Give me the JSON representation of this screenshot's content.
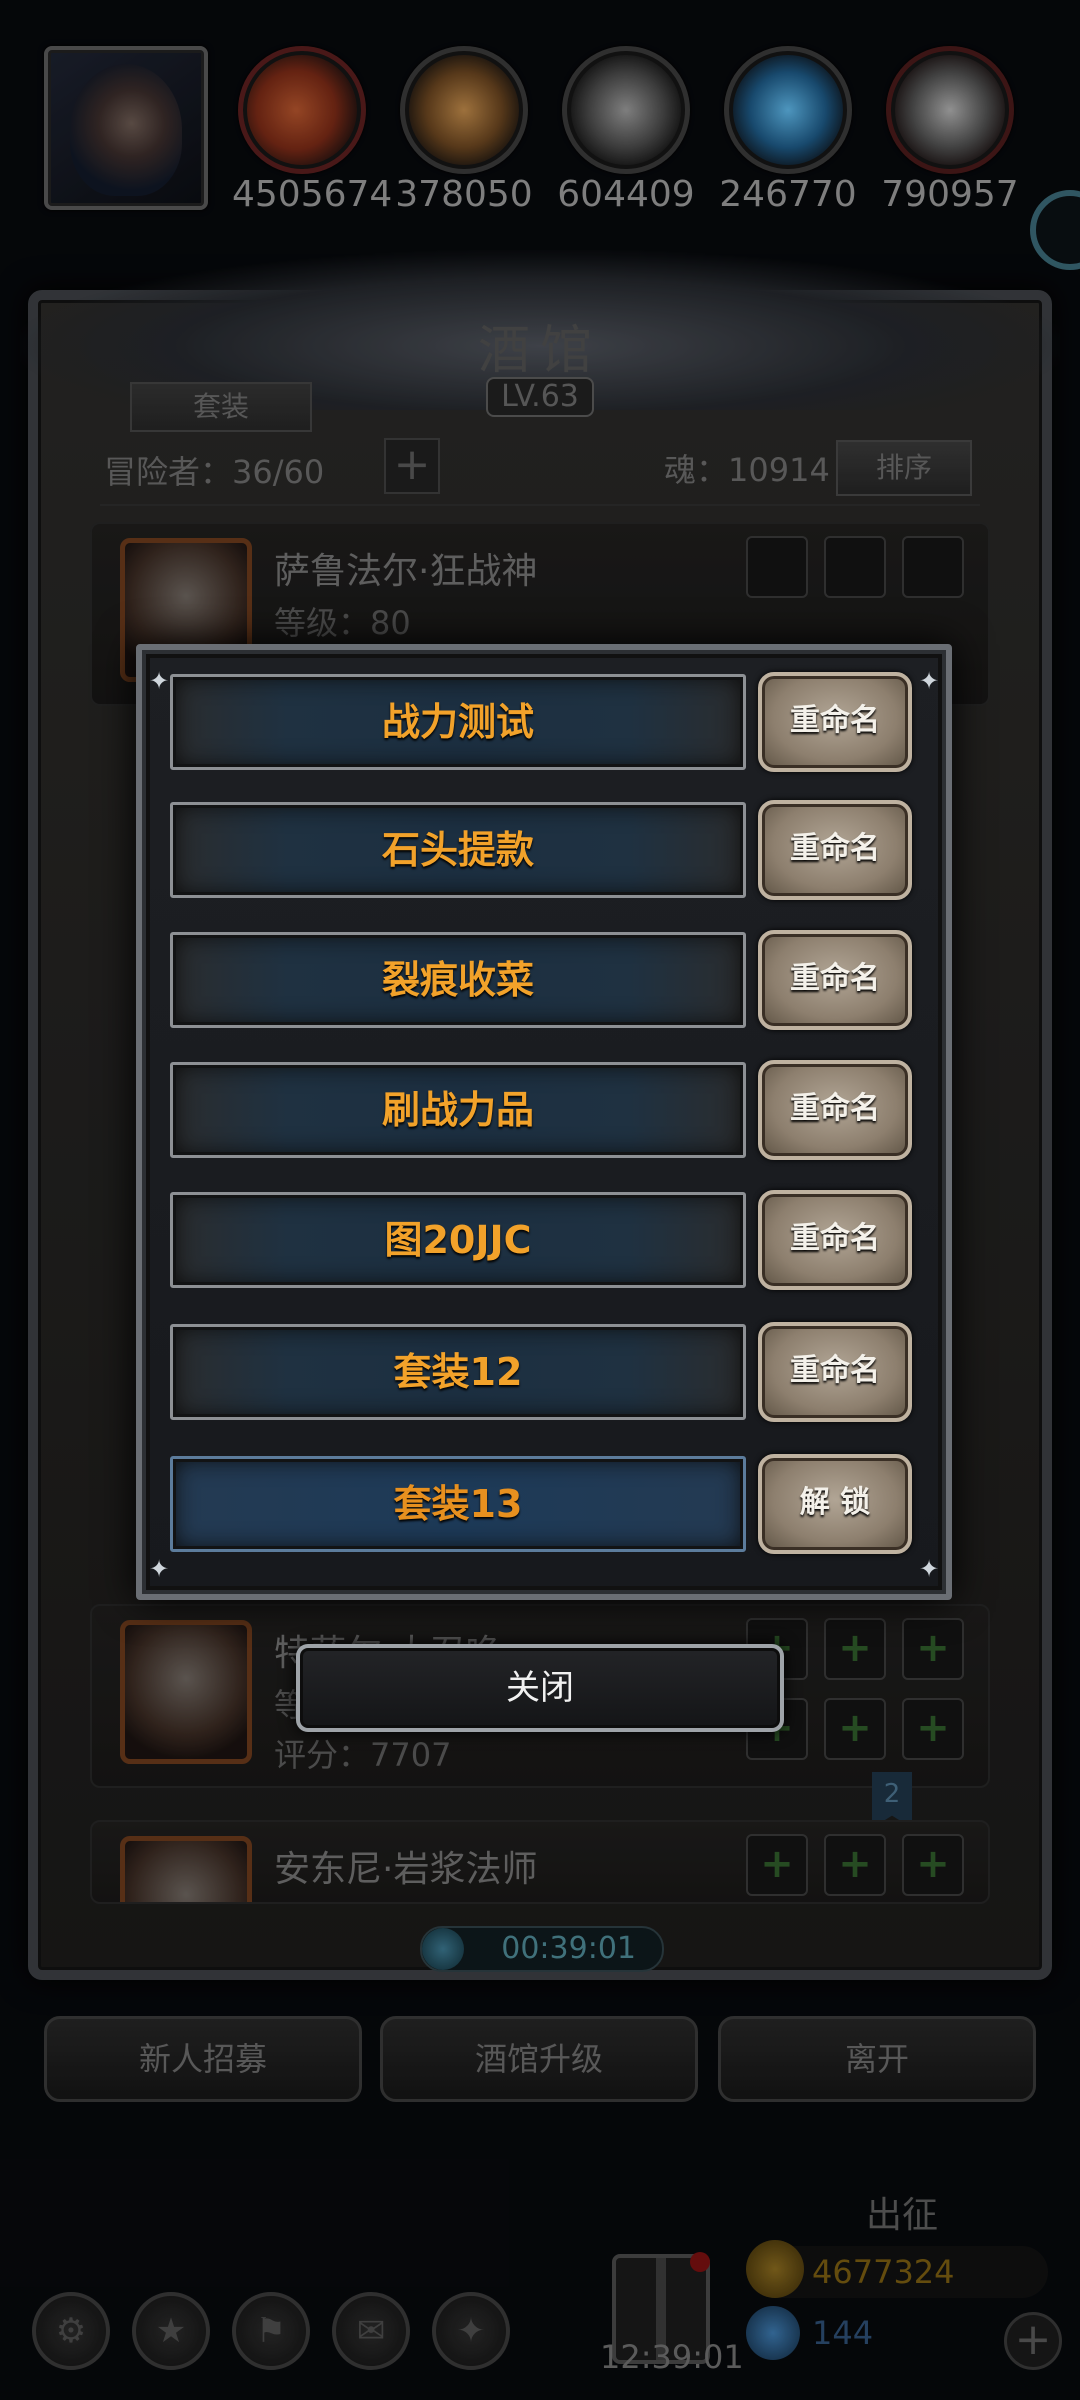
{
  "resources": [
    {
      "icon": "meat-icon",
      "value": "4505674"
    },
    {
      "icon": "wood-icon",
      "value": "378050"
    },
    {
      "icon": "iron-icon",
      "value": "604409"
    },
    {
      "icon": "crystal-icon",
      "value": "246770"
    },
    {
      "icon": "metal-icon",
      "value": "790957"
    }
  ],
  "tavern": {
    "title": "酒馆",
    "level": "LV.63",
    "set_tab": "套装",
    "adventurers": "冒险者：36/60",
    "add_symbol": "+",
    "soul": "魂：10914",
    "sort": "排序"
  },
  "heroes": [
    {
      "name": "萨鲁法尔·狂战神",
      "level": "等级：80"
    },
    {
      "name": "特萨尔·大召唤",
      "level": "等",
      "score": "评分：7707"
    },
    {
      "name": "安东尼·岩浆法师"
    }
  ],
  "page_flag": "2",
  "timer": "00:39:01",
  "bottom_buttons": {
    "recruit": "新人招募",
    "upgrade": "酒馆升级",
    "leave": "离开"
  },
  "footer": {
    "expedition": "出征",
    "clock": "12:39:01",
    "gold": "4677324",
    "gems": "144",
    "plus": "+"
  },
  "modal": {
    "sets": [
      {
        "name": "战力测试",
        "action": "重命名"
      },
      {
        "name": "石头提款",
        "action": "重命名"
      },
      {
        "name": "裂痕收菜",
        "action": "重命名"
      },
      {
        "name": "刷战力品",
        "action": "重命名"
      },
      {
        "name": "图20JJC",
        "action": "重命名"
      },
      {
        "name": "套装12",
        "action": "重命名"
      },
      {
        "name": "套装13",
        "action": "解 锁",
        "locked": true
      }
    ],
    "close": "关闭"
  },
  "colors": {
    "set_name_text": "#f2a22a",
    "rename_button": "#a89a88",
    "modal_border": "#6a6e74"
  }
}
